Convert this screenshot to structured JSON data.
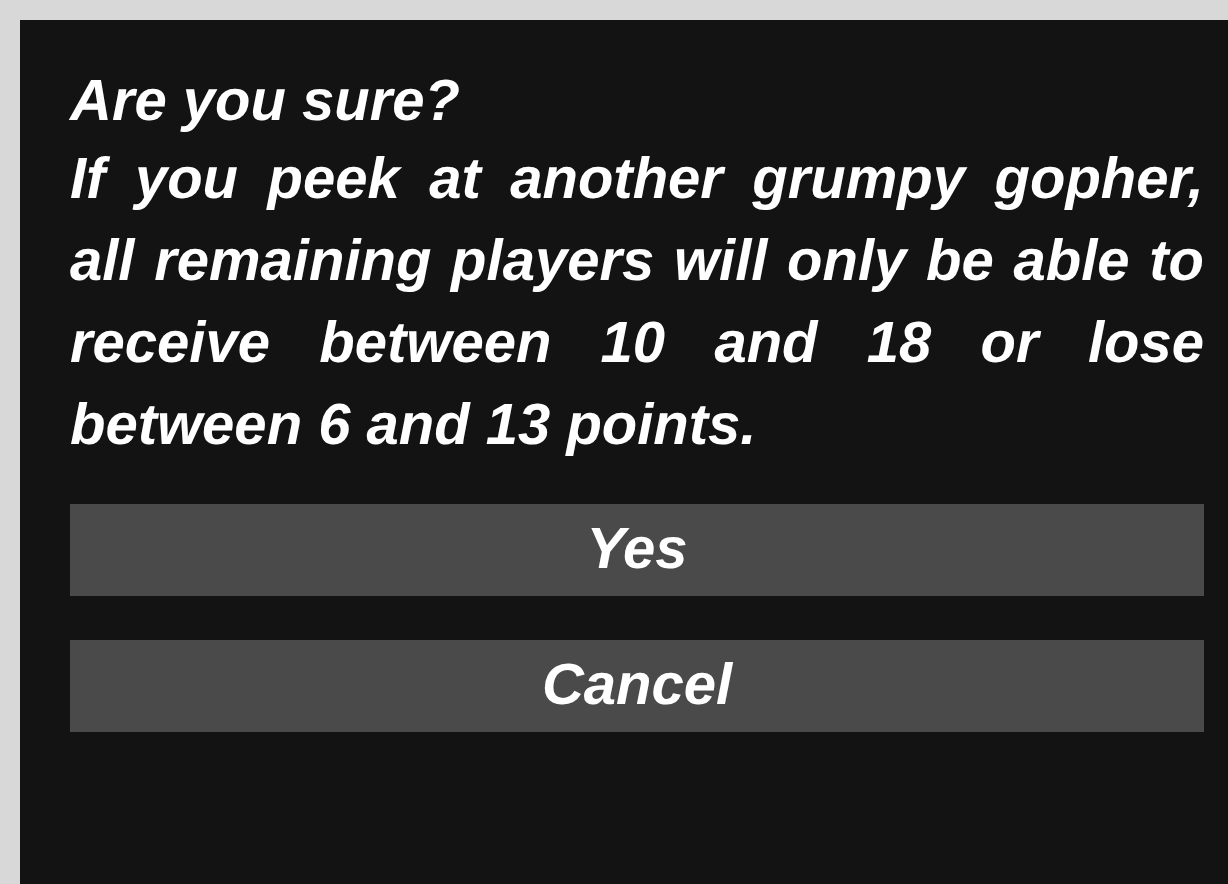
{
  "dialog": {
    "title": "Are you sure?",
    "message": "If you peek at another grumpy gopher, all remaining players will only be able to receive between 10 and 18 or lose between 6 and 13 points.",
    "buttons": [
      {
        "label": "Yes"
      },
      {
        "label": "Cancel"
      }
    ]
  }
}
